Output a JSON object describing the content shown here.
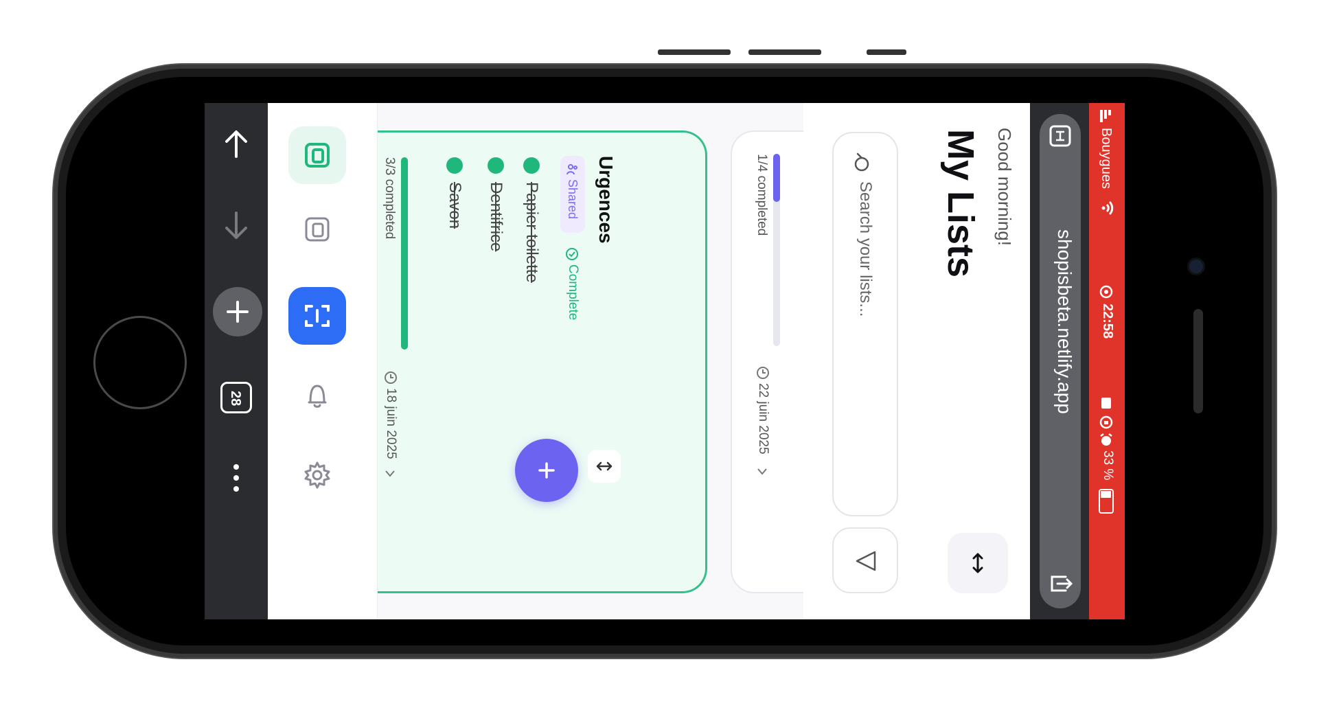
{
  "status_bar": {
    "carrier": "Bouygues",
    "time": "22:58",
    "battery": "33 %",
    "bg_color": "#e0342b"
  },
  "browser": {
    "url": "shopisbeta.netlify.app"
  },
  "toolbar": {
    "tab_count": "28",
    "icons": [
      "arrow-up-icon",
      "arrow-down-icon",
      "plus-icon",
      "tabs-icon",
      "more-vert-icon"
    ]
  },
  "header": {
    "greeting": "Good morning!",
    "title": "My Lists",
    "search_placeholder": "Search your lists..."
  },
  "lists": [
    {
      "title": "Urgences",
      "shared_label": "Shared",
      "status_label": "Complete",
      "items": [
        {
          "label": "Papier toilette",
          "done": true
        },
        {
          "label": "Dentifrice",
          "done": true
        },
        {
          "label": "Savon",
          "done": true
        }
      ],
      "progress_text": "3/3 completed",
      "progress": 1.0,
      "date": "18 juin 2025"
    },
    {
      "progress_text": "1/4 completed",
      "progress": 0.25,
      "date": "22 juin 2025"
    }
  ],
  "fab_label": "+",
  "colors": {
    "accent_green": "#1fb77c",
    "accent_purple": "#6c63f0",
    "accent_blue": "#2d6df6",
    "shared_purple": "#7b6cf6"
  }
}
